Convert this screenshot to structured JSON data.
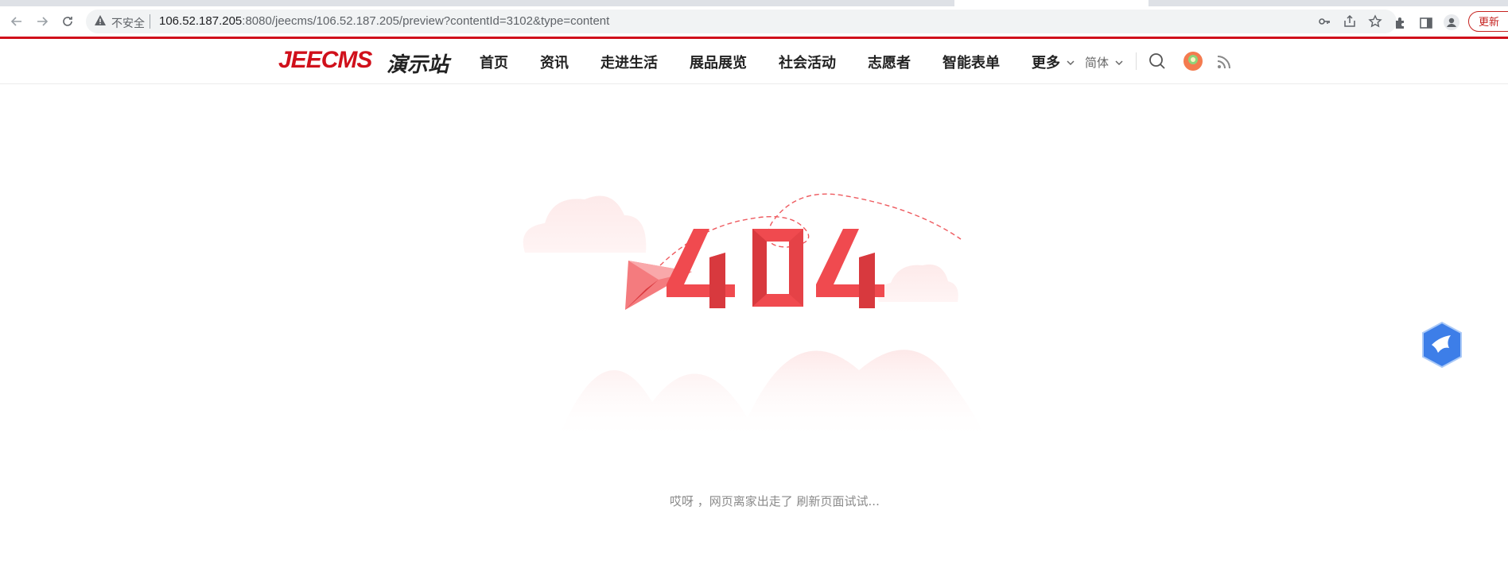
{
  "browser": {
    "security_label": "不安全",
    "url_host": "106.52.187.205",
    "url_rest": ":8080/jeecms/106.52.187.205/preview?contentId=3102&type=content",
    "update_label": "更新"
  },
  "site": {
    "logo_text": "JEECMS",
    "logo_sub": "演示站",
    "nav": [
      "首页",
      "资讯",
      "走进生活",
      "展品展览",
      "社会活动",
      "志愿者",
      "智能表单",
      "更多"
    ],
    "lang_label": "简体"
  },
  "error": {
    "code": "404",
    "message": "哎呀 ，网页离家出走了 刷新页面试试..."
  },
  "colors": {
    "brand_red": "#d0101b",
    "error_red": "#f04a4f"
  }
}
